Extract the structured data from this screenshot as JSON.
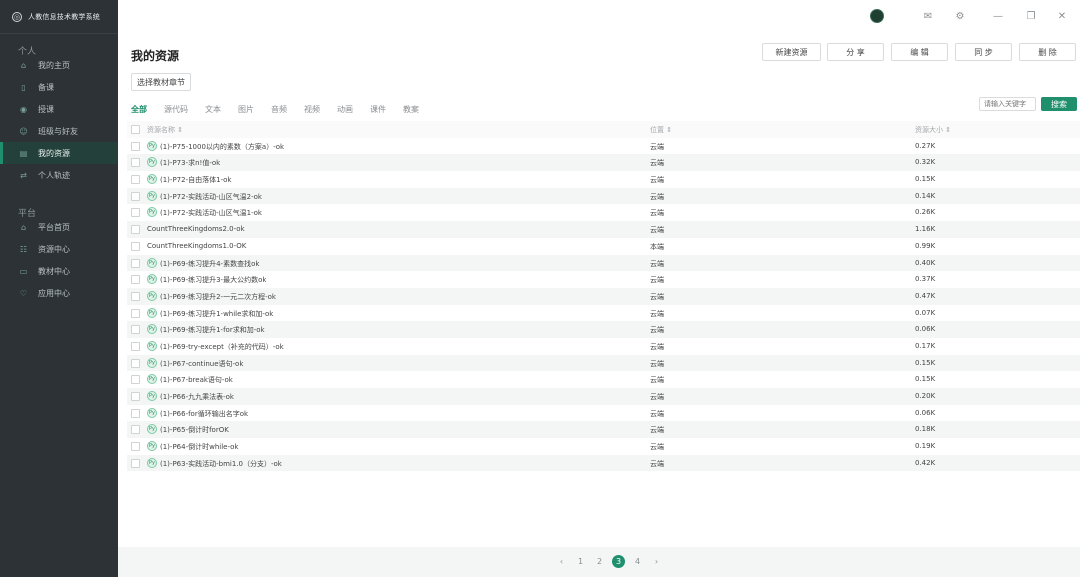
{
  "app": {
    "title": "人教信息技术教学系统"
  },
  "sidebar": {
    "sections": [
      {
        "title": "个人",
        "items": [
          {
            "label": "我的主页",
            "icon": "home-icon"
          },
          {
            "label": "备课",
            "icon": "book-icon"
          },
          {
            "label": "授课",
            "icon": "teach-icon"
          },
          {
            "label": "班级与好友",
            "icon": "users-icon"
          },
          {
            "label": "我的资源",
            "icon": "folder-icon",
            "active": true
          },
          {
            "label": "个人轨迹",
            "icon": "track-icon"
          }
        ]
      },
      {
        "title": "平台",
        "items": [
          {
            "label": "平台首页",
            "icon": "platform-home-icon"
          },
          {
            "label": "资源中心",
            "icon": "resource-center-icon"
          },
          {
            "label": "教材中心",
            "icon": "textbook-icon"
          },
          {
            "label": "应用中心",
            "icon": "apps-icon"
          }
        ]
      }
    ]
  },
  "main": {
    "title": "我的资源",
    "choose_chapter": "选择教材章节",
    "actions": [
      "新建资源",
      "分 享",
      "编 辑",
      "同 步",
      "删 除"
    ],
    "tabs": [
      "全部",
      "源代码",
      "文本",
      "图片",
      "音频",
      "视频",
      "动画",
      "课件",
      "教案"
    ],
    "search_placeholder": "请输入关键字",
    "search_label": "搜索",
    "columns": {
      "name": "资源名称 ⇕",
      "pos": "位置 ⇕",
      "size": "资源大小 ⇕"
    },
    "rows": [
      {
        "name": "(1)-P75-1000以内的素数（方案a）-ok",
        "pos": "云端",
        "size": "0.27K",
        "icon": true
      },
      {
        "name": "(1)-P73-求n!值-ok",
        "pos": "云端",
        "size": "0.32K",
        "icon": true
      },
      {
        "name": "(1)-P72-自由落体1-ok",
        "pos": "云端",
        "size": "0.15K",
        "icon": true
      },
      {
        "name": "(1)-P72-实践活动-山区气温2-ok",
        "pos": "云端",
        "size": "0.14K",
        "icon": true
      },
      {
        "name": "(1)-P72-实践活动-山区气温1-ok",
        "pos": "云端",
        "size": "0.26K",
        "icon": true
      },
      {
        "name": "CountThreeKingdoms2.0-ok",
        "pos": "云端",
        "size": "1.16K",
        "icon": false
      },
      {
        "name": "CountThreeKingdoms1.0-OK",
        "pos": "本端",
        "size": "0.99K",
        "icon": false
      },
      {
        "name": "(1)-P69-练习提升4-素数查找ok",
        "pos": "云端",
        "size": "0.40K",
        "icon": true
      },
      {
        "name": "(1)-P69-练习提升3-最大公约数ok",
        "pos": "云端",
        "size": "0.37K",
        "icon": true
      },
      {
        "name": "(1)-P69-练习提升2-一元二次方程-ok",
        "pos": "云端",
        "size": "0.47K",
        "icon": true
      },
      {
        "name": "(1)-P69-练习提升1-while求和加-ok",
        "pos": "云端",
        "size": "0.07K",
        "icon": true
      },
      {
        "name": "(1)-P69-练习提升1-for求和加-ok",
        "pos": "云端",
        "size": "0.06K",
        "icon": true
      },
      {
        "name": "(1)-P69-try-except（补充的代码）-ok",
        "pos": "云端",
        "size": "0.17K",
        "icon": true
      },
      {
        "name": "(1)-P67-continue语句-ok",
        "pos": "云端",
        "size": "0.15K",
        "icon": true
      },
      {
        "name": "(1)-P67-break语句-ok",
        "pos": "云端",
        "size": "0.15K",
        "icon": true
      },
      {
        "name": "(1)-P66-九九乘法表-ok",
        "pos": "云端",
        "size": "0.20K",
        "icon": true
      },
      {
        "name": "(1)-P66-for循环输出名字ok",
        "pos": "云端",
        "size": "0.06K",
        "icon": true
      },
      {
        "name": "(1)-P65-倒计时forOK",
        "pos": "云端",
        "size": "0.18K",
        "icon": true
      },
      {
        "name": "(1)-P64-倒计时while-ok",
        "pos": "云端",
        "size": "0.19K",
        "icon": true
      },
      {
        "name": "(1)-P63-实践活动-bmi1.0（分支）-ok",
        "pos": "云端",
        "size": "0.42K",
        "icon": true
      }
    ]
  },
  "pagination": {
    "prev": "‹",
    "next": "›",
    "pages": [
      "1",
      "2",
      "3",
      "4"
    ],
    "current": "3"
  },
  "colors": {
    "accent": "#1f8f6d",
    "sidebar": "#2c3236"
  }
}
